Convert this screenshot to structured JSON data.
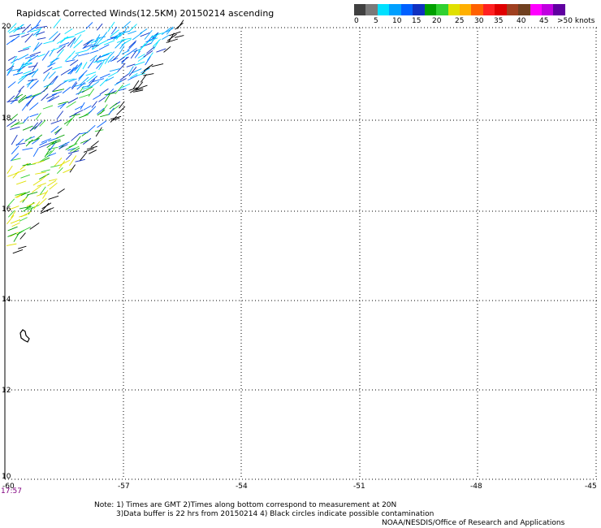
{
  "title": "Rapidscat Corrected Winds(12.5KM) 20150214 ascending",
  "colorbar": {
    "colors": [
      "#404040",
      "#7a7a7a",
      "#00e0ff",
      "#00a0ff",
      "#0060ff",
      "#1030c0",
      "#00a000",
      "#30d030",
      "#e0e000",
      "#ffb000",
      "#ff6000",
      "#ff2020",
      "#e00000",
      "#a04020",
      "#704020",
      "#ff00ff",
      "#c000e0",
      "#6000a0"
    ],
    "labels": [
      "0",
      "5",
      "10",
      "15",
      "20",
      "25",
      "30",
      "35",
      "40",
      "45",
      ">50 knots"
    ]
  },
  "axes": {
    "lat_labels": [
      "20",
      "18",
      "16",
      "14",
      "12",
      "10"
    ],
    "lon_labels": [
      "-60",
      "-57",
      "-54",
      "-51",
      "-48",
      "-45"
    ]
  },
  "time_label": "17:57",
  "notes": {
    "line1": "Note: 1) Times are GMT 2)Times along bottom correspond to measurement at 20N",
    "line2": "3)Data buffer is 22 hrs from 20150214 4) Black circles indicate possible contamination",
    "line3": "NOAA/NESDIS/Office of Research and Applications"
  }
}
